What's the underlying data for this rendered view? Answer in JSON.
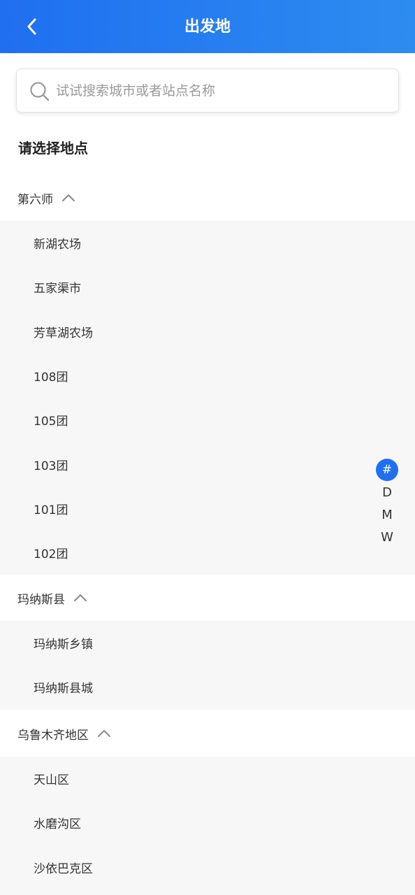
{
  "header": {
    "title": "出发地",
    "back_icon": "chevron-left-icon"
  },
  "search": {
    "placeholder": "试试搜索城市或者站点名称",
    "value": "",
    "icon": "search-icon"
  },
  "section_title": "请选择地点",
  "groups": [
    {
      "label": "第六师",
      "expanded": true,
      "items": [
        "新湖农场",
        "五家渠市",
        "芳草湖农场",
        "108团",
        "105团",
        "103团",
        "101团",
        "102团"
      ]
    },
    {
      "label": "玛纳斯县",
      "expanded": true,
      "items": [
        "玛纳斯乡镇",
        "玛纳斯县城"
      ]
    },
    {
      "label": "乌鲁木齐地区",
      "expanded": true,
      "items": [
        "天山区",
        "水磨沟区",
        "沙依巴克区"
      ]
    }
  ],
  "index_bar": {
    "letters": [
      "#",
      "D",
      "M",
      "W"
    ],
    "active": "#"
  },
  "colors": {
    "primary": "#1f6ff0",
    "header_gradient_end": "#2d8cf0",
    "list_bg": "#f7f7f7",
    "text": "#333333",
    "placeholder": "#9a9a9a"
  }
}
